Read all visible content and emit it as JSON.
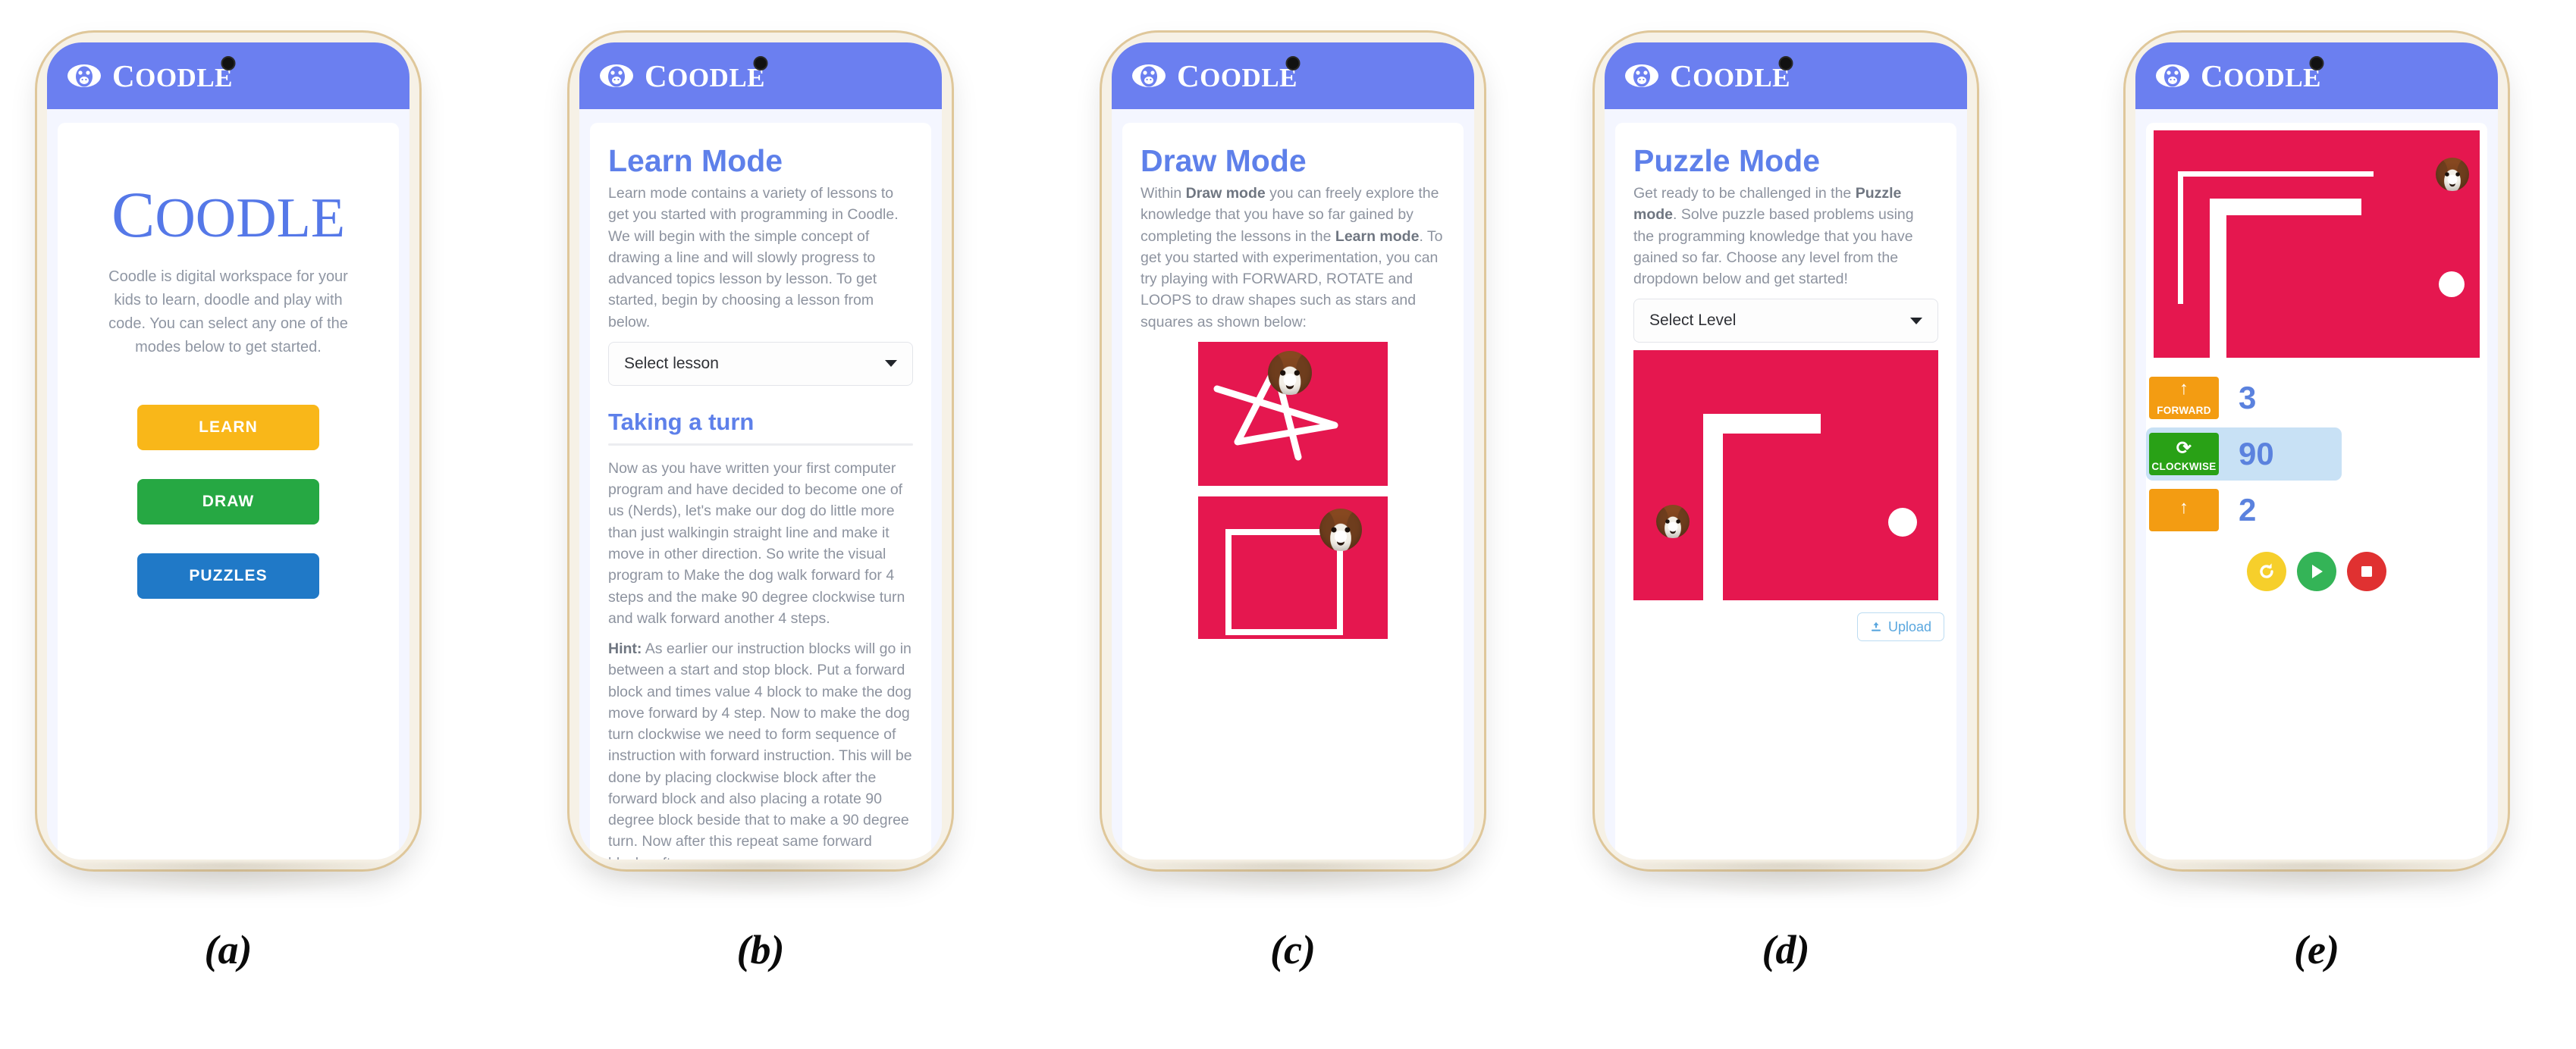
{
  "brand": {
    "name": "Coodle",
    "logo_icon": "monkey-face-icon"
  },
  "figure": {
    "captions": [
      "(a)",
      "(b)",
      "(c)",
      "(d)",
      "(e)"
    ]
  },
  "screens": {
    "home": {
      "title": "Coodle",
      "description": "Coodle is digital workspace for your kids to learn, doodle and play with code. You can select any one of the modes below to get started.",
      "buttons": [
        {
          "label": "LEARN",
          "color": "#f9b719"
        },
        {
          "label": "DRAW",
          "color": "#26a843"
        },
        {
          "label": "PUZZLES",
          "color": "#2079c7"
        }
      ]
    },
    "learn": {
      "title": "Learn Mode",
      "description": "Learn mode contains a variety of lessons to get you started with programming in Coodle. We will begin with the simple concept of drawing a line and will slowly progress to advanced topics lesson by lesson. To get started, begin by choosing a lesson from below.",
      "select_value": "Select lesson",
      "lesson_title": "Taking a turn",
      "lesson_body": "Now as you have written your first computer program and have decided to become one of us (Nerds), let's make our dog do little more than just walkingin straight line and make it move in other direction. So write the visual program to Make the dog walk forward for 4 steps and the make 90 degree clockwise turn and walk forward another 4 steps.",
      "hint_label": "Hint:",
      "hint_body": " As earlier our instruction blocks will go in between a start and stop block. Put a forward block and times value 4 block to make the dog move forward by 4 step. Now to make the dog turn clockwise we need to form sequence of instruction with forward instruction. This will be done by placing clockwise block after the forward block and also placing a rotate 90 degree block beside that to make a 90 degree turn. Now after this repeat same forward blocks after"
    },
    "draw": {
      "title": "Draw Mode",
      "description_parts": [
        "Within ",
        "Draw mode",
        "  you can freely explore the knowledge that you have so far gained by completing the lessons in the ",
        "Learn mode",
        ". To get you started with experimentation, you can try playing with FORWARD, ROTATE and LOOPS to draw shapes such as stars and squares as shown below:"
      ],
      "canvas_bg": "#e5174f",
      "shapes": [
        "star",
        "square"
      ]
    },
    "puzzle": {
      "title": "Puzzle Mode",
      "description_parts": [
        "Get ready to be challenged in the ",
        "Puzzle mode",
        ". Solve puzzle based problems using the programming knowledge that you have gained so far. Choose any level from the dropdown below and get started!"
      ],
      "select_value": "Select Level",
      "upload_label": "Upload",
      "upload_icon": "upload-icon",
      "canvas_bg": "#e5174f"
    },
    "run": {
      "canvas_bg": "#e5174f",
      "blocks": [
        {
          "label": "FORWARD",
          "icon": "arrow-up-icon",
          "value": "3",
          "color": "#f39c12",
          "selected": false
        },
        {
          "label": "CLOCKWISE",
          "icon": "rotate-clockwise-icon",
          "value": "90",
          "color": "#29a116",
          "selected": true
        },
        {
          "label": "",
          "icon": "arrow-up-icon",
          "value": "2",
          "color": "#f39c12",
          "selected": false
        }
      ],
      "controls": [
        {
          "name": "reset",
          "icon": "refresh-icon",
          "color": "#f6cf2b"
        },
        {
          "name": "run",
          "icon": "play-icon",
          "color": "#34b457"
        },
        {
          "name": "stop",
          "icon": "stop-icon",
          "color": "#e03131"
        }
      ]
    }
  }
}
